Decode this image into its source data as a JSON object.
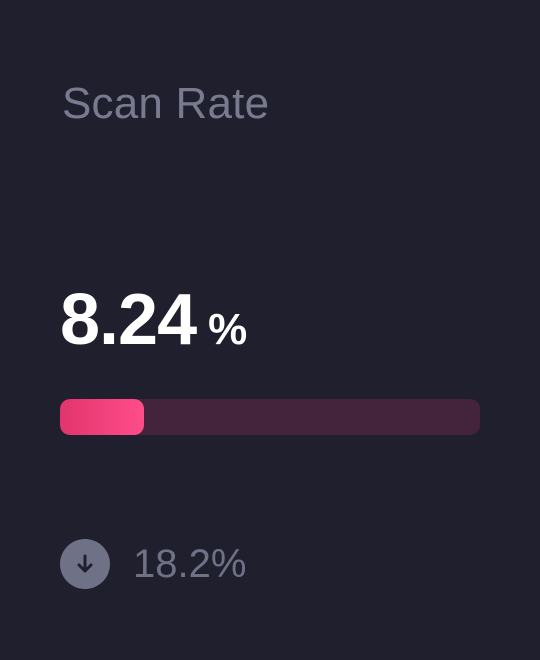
{
  "card": {
    "title": "Scan Rate",
    "value": "8.24",
    "unit": "%",
    "progress_fraction": 0.2,
    "accent_color": "#ff4d8a",
    "track_color": "#44243c"
  },
  "delta": {
    "direction": "down",
    "icon": "arrow-down-icon",
    "text": "18.2%"
  }
}
